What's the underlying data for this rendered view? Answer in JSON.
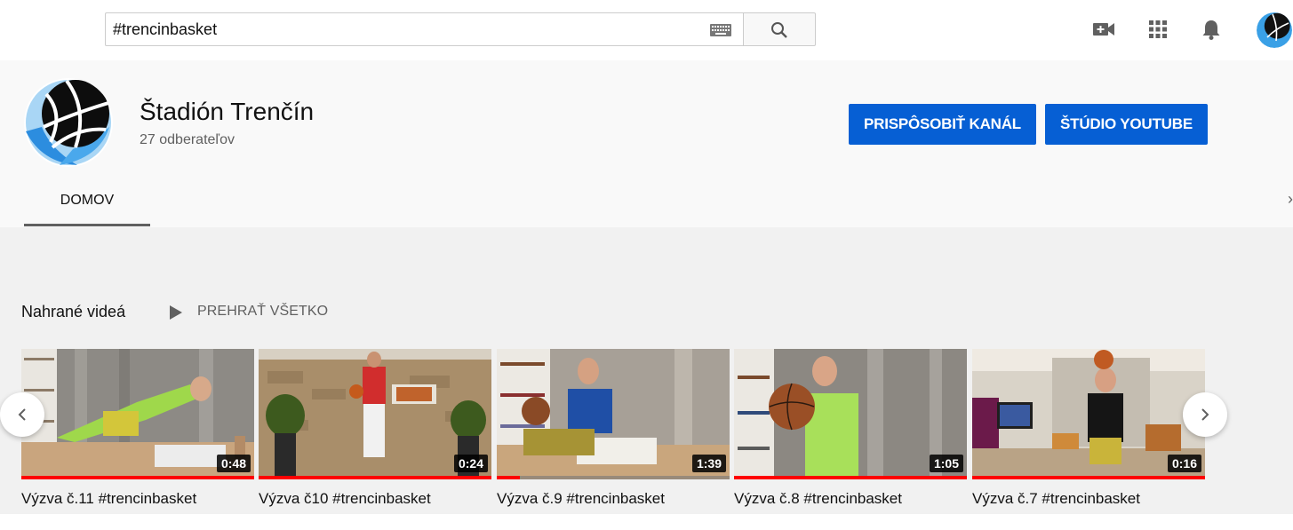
{
  "search": {
    "value": "#trencinbasket"
  },
  "channel": {
    "name": "Štadión Trenčín",
    "subscribers": "27 odberateľov",
    "customize_label": "PRISPÔSOBIŤ KANÁL",
    "studio_label": "ŠTÚDIO YOUTUBE",
    "tabs": [
      {
        "label": "DOMOV",
        "selected": true
      }
    ]
  },
  "shelf": {
    "title": "Nahrané videá",
    "play_all_label": "PREHRAŤ VŠETKO",
    "videos": [
      {
        "title": "Výzva č.11 #trencinbasket",
        "duration": "0:48",
        "watched": 1.0
      },
      {
        "title": "Výzva č10 #trencinbasket",
        "duration": "0:24",
        "watched": 1.0
      },
      {
        "title": "Výzva č.9 #trencinbasket",
        "duration": "1:39",
        "watched": 0.1
      },
      {
        "title": "Výzva č.8 #trencinbasket",
        "duration": "1:05",
        "watched": 1.0
      },
      {
        "title": "Výzva č.7 #trencinbasket",
        "duration": "0:16",
        "watched": 1.0
      }
    ]
  },
  "colors": {
    "accent_blue": "#065fd4",
    "progress_red": "#ff0000",
    "logo_blue": "#3aa0e6"
  },
  "icons": [
    "keyboard-icon",
    "search-icon",
    "create-video-icon",
    "apps-grid-icon",
    "bell-icon",
    "play-icon",
    "chevron-left-icon",
    "chevron-right-icon"
  ]
}
